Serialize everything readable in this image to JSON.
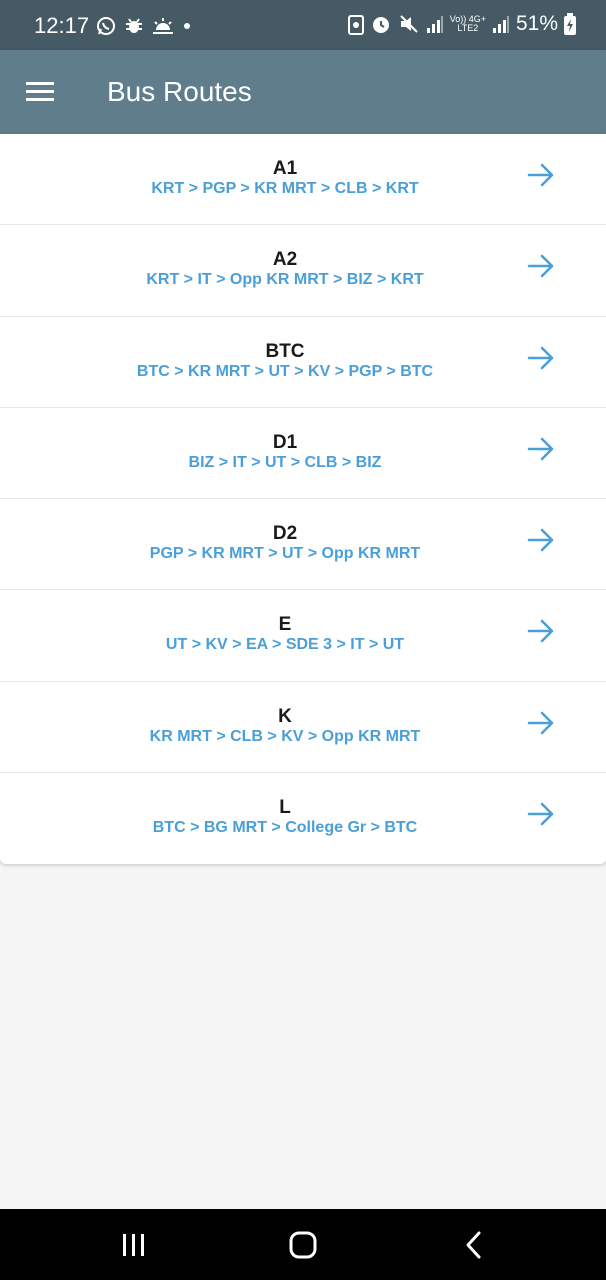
{
  "status_bar": {
    "time": "12:17",
    "battery": "51%",
    "network_top": "Vo)) 4G+",
    "network_bottom": "LTE2"
  },
  "app_bar": {
    "title": "Bus Routes",
    "menu_icon": "hamburger-menu-icon"
  },
  "routes": [
    {
      "name": "A1",
      "path": "KRT > PGP > KR MRT > CLB > KRT"
    },
    {
      "name": "A2",
      "path": "KRT > IT > Opp KR MRT > BIZ > KRT"
    },
    {
      "name": "BTC",
      "path": "BTC > KR MRT > UT > KV > PGP > BTC"
    },
    {
      "name": "D1",
      "path": "BIZ > IT > UT > CLB > BIZ"
    },
    {
      "name": "D2",
      "path": "PGP > KR MRT > UT > Opp KR MRT"
    },
    {
      "name": "E",
      "path": "UT > KV > EA > SDE 3 > IT > UT"
    },
    {
      "name": "K",
      "path": "KR MRT > CLB > KV > Opp KR MRT"
    },
    {
      "name": "L",
      "path": "BTC > BG MRT > College Gr > BTC"
    }
  ],
  "colors": {
    "status_bar": "#455a64",
    "app_bar": "#607d8b",
    "accent": "#4a9fd8",
    "background": "#f5f5f5"
  },
  "icons": {
    "route_arrow": "arrow-right-icon",
    "nav_recents": "recents-icon",
    "nav_home": "home-icon",
    "nav_back": "back-icon"
  }
}
